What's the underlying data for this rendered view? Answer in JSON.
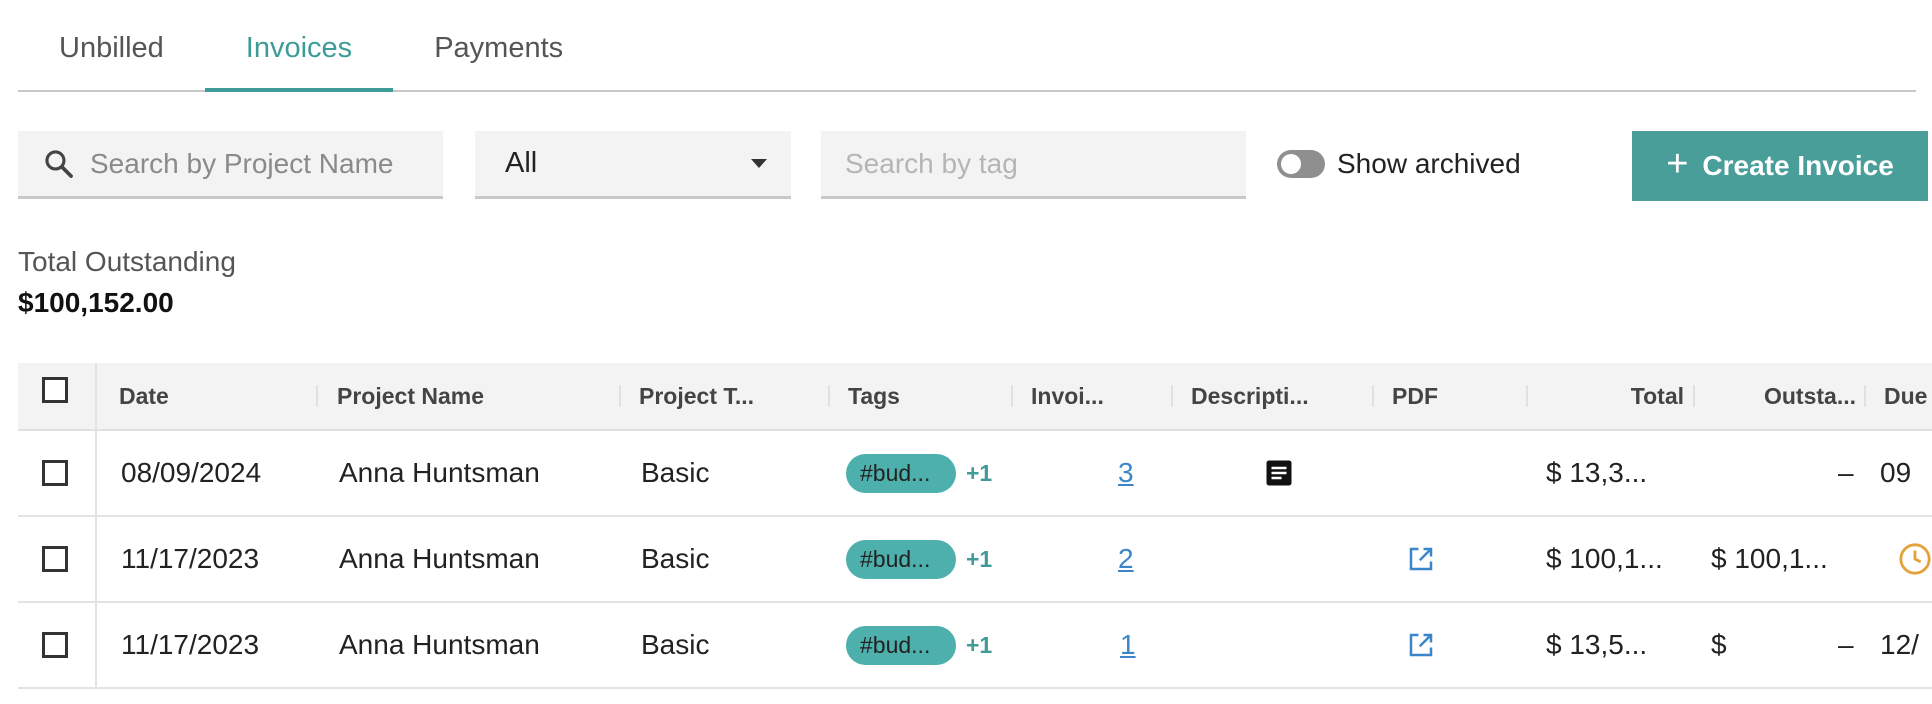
{
  "tabs": [
    {
      "label": "Unbilled",
      "active": false
    },
    {
      "label": "Invoices",
      "active": true
    },
    {
      "label": "Payments",
      "active": false
    }
  ],
  "toolbar": {
    "search_placeholder": "Search by Project Name",
    "filter_value": "All",
    "tag_placeholder": "Search by tag",
    "archived_label": "Show archived",
    "archived_on": false,
    "create_label": "Create Invoice"
  },
  "summary": {
    "label": "Total Outstanding",
    "value": "$100,152.00"
  },
  "table": {
    "headers": {
      "date": "Date",
      "project": "Project Name",
      "type": "Project T...",
      "tags": "Tags",
      "invoice": "Invoi...",
      "description": "Descripti...",
      "pdf": "PDF",
      "total": "Total",
      "outstanding": "Outsta...",
      "due": "Due"
    },
    "rows": [
      {
        "date": "08/09/2024",
        "project": "Anna Huntsman",
        "type": "Basic",
        "tag": "#bud...",
        "tag_more": "+1",
        "invoice": "3",
        "total": "$ 13,3...",
        "out_cur": "",
        "out_val": "–",
        "due": "09"
      },
      {
        "date": "11/17/2023",
        "project": "Anna Huntsman",
        "type": "Basic",
        "tag": "#bud...",
        "tag_more": "+1",
        "invoice": "2",
        "total": "$ 100,1...",
        "out_cur": "$ 100,1...",
        "out_val": "",
        "due": ""
      },
      {
        "date": "11/17/2023",
        "project": "Anna Huntsman",
        "type": "Basic",
        "tag": "#bud...",
        "tag_more": "+1",
        "invoice": "1",
        "total": "$ 13,5...",
        "out_cur": "$",
        "out_val": "–",
        "due": "12/"
      }
    ]
  },
  "colors": {
    "accent": "#3f9b98",
    "button": "#4a9e9a",
    "tag": "#4db0ac",
    "link": "#3a86c8",
    "clock": "#e2a33d"
  },
  "icons": [
    "search-icon",
    "chevron-down-icon",
    "plus-icon",
    "description-icon",
    "external-link-icon",
    "clock-icon"
  ]
}
